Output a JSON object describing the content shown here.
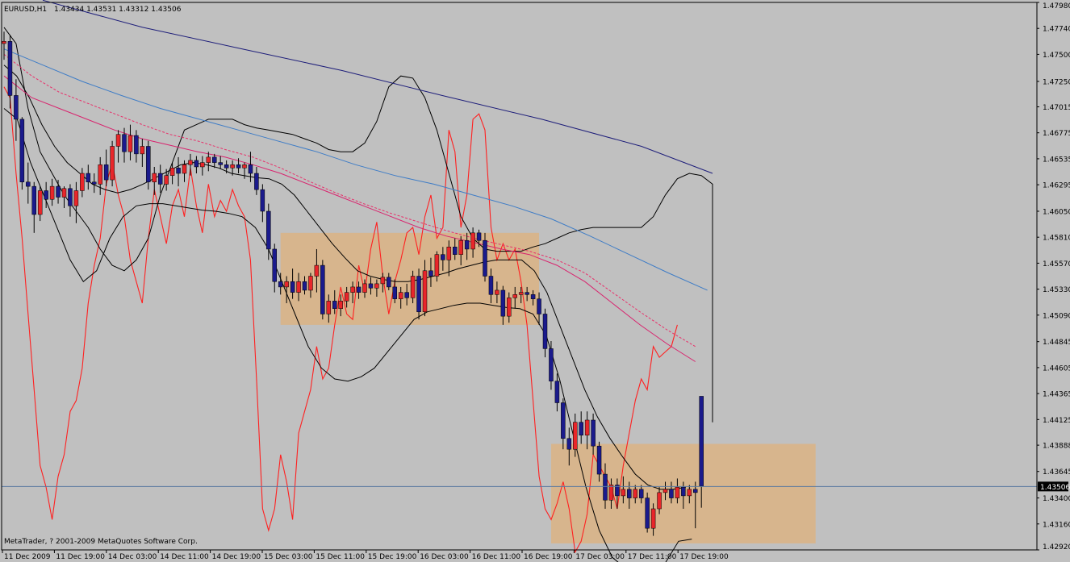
{
  "header": {
    "symbol": "EURUSD,H1",
    "ohlc": "1.43434 1.43531 1.43312 1.43506"
  },
  "footer": {
    "copyright": "MetaTrader, ? 2001-2009 MetaQuotes Software Corp."
  },
  "current_price": {
    "value": 1.43506,
    "label": "1.43506"
  },
  "colors": {
    "background": "#c0c0c0",
    "bull_candle": "#e8262a",
    "bear_candle": "#1a1a8c",
    "wick": "#000000",
    "red_oscillator": "#ff2020",
    "bollinger": "#000000",
    "ma_pink": "#d8246e",
    "ma_pink_dashed": "#e8306a",
    "ma_blue": "#3e7cc6",
    "ma_navy": "#1e1e7a",
    "zone_fill": "#d8b48a",
    "price_line": "#5878a0"
  },
  "chart_data": {
    "type": "candlestick",
    "symbol": "EURUSD",
    "timeframe": "H1",
    "ylim": [
      1.4292,
      1.4798
    ],
    "y_ticks": [
      "1.47980",
      "1.47740",
      "1.47500",
      "1.47250",
      "1.47015",
      "1.46775",
      "1.46535",
      "1.46295",
      "1.46050",
      "1.45810",
      "1.45570",
      "1.45330",
      "1.45090",
      "1.44845",
      "1.44605",
      "1.44365",
      "1.44125",
      "1.43888",
      "1.43645",
      "1.43400",
      "1.43160",
      "1.42920"
    ],
    "x_ticks": [
      "11 Dec 2009",
      "11 Dec 19:00",
      "14 Dec 03:00",
      "14 Dec 11:00",
      "14 Dec 19:00",
      "15 Dec 03:00",
      "15 Dec 11:00",
      "15 Dec 19:00",
      "16 Dec 03:00",
      "16 Dec 11:00",
      "16 Dec 19:00",
      "17 Dec 03:00",
      "17 Dec 11:00",
      "17 Dec 19:00"
    ],
    "grid": false,
    "zones": [
      {
        "from_bar": 46,
        "to_bar": 89,
        "top": 1.4585,
        "bottom": 1.45
      },
      {
        "from_bar": 91,
        "to_bar": 135,
        "top": 1.439,
        "bottom": 1.4298
      }
    ],
    "candles": [
      [
        1.476,
        1.4771,
        1.4745,
        1.4762
      ],
      [
        1.4762,
        1.4768,
        1.47,
        1.4712
      ],
      [
        1.4712,
        1.4727,
        1.467,
        1.469
      ],
      [
        1.469,
        1.4692,
        1.4625,
        1.4632
      ],
      [
        1.4632,
        1.465,
        1.4612,
        1.4628
      ],
      [
        1.4628,
        1.4632,
        1.4585,
        1.4602
      ],
      [
        1.4602,
        1.4628,
        1.4596,
        1.4624
      ],
      [
        1.4624,
        1.4632,
        1.4608,
        1.4616
      ],
      [
        1.4616,
        1.4635,
        1.461,
        1.4628
      ],
      [
        1.4628,
        1.4634,
        1.4612,
        1.4618
      ],
      [
        1.4618,
        1.4628,
        1.4608,
        1.4626
      ],
      [
        1.4626,
        1.463,
        1.46,
        1.461
      ],
      [
        1.461,
        1.4632,
        1.4594,
        1.4624
      ],
      [
        1.4624,
        1.4645,
        1.4618,
        1.464
      ],
      [
        1.464,
        1.4648,
        1.4625,
        1.4632
      ],
      [
        1.4632,
        1.464,
        1.4622,
        1.463
      ],
      [
        1.463,
        1.4655,
        1.462,
        1.4648
      ],
      [
        1.4648,
        1.4662,
        1.4628,
        1.4634
      ],
      [
        1.4634,
        1.467,
        1.4628,
        1.4665
      ],
      [
        1.4665,
        1.468,
        1.465,
        1.4676
      ],
      [
        1.4676,
        1.4682,
        1.465,
        1.466
      ],
      [
        1.466,
        1.4685,
        1.4652,
        1.4675
      ],
      [
        1.4675,
        1.468,
        1.465,
        1.4658
      ],
      [
        1.4658,
        1.4672,
        1.4646,
        1.4665
      ],
      [
        1.4665,
        1.467,
        1.4625,
        1.4632
      ],
      [
        1.4632,
        1.4646,
        1.462,
        1.464
      ],
      [
        1.464,
        1.4648,
        1.4622,
        1.463
      ],
      [
        1.463,
        1.4644,
        1.4624,
        1.4638
      ],
      [
        1.4638,
        1.465,
        1.463,
        1.4645
      ],
      [
        1.4645,
        1.4655,
        1.4628,
        1.464
      ],
      [
        1.464,
        1.4652,
        1.4632,
        1.4648
      ],
      [
        1.4648,
        1.4658,
        1.4638,
        1.4652
      ],
      [
        1.4652,
        1.4656,
        1.464,
        1.4646
      ],
      [
        1.4646,
        1.4656,
        1.4638,
        1.465
      ],
      [
        1.465,
        1.466,
        1.4642,
        1.4655
      ],
      [
        1.4655,
        1.4658,
        1.4645,
        1.465
      ],
      [
        1.465,
        1.4656,
        1.4644,
        1.4648
      ],
      [
        1.4648,
        1.4652,
        1.464,
        1.4645
      ],
      [
        1.4645,
        1.4652,
        1.4638,
        1.4648
      ],
      [
        1.4648,
        1.4654,
        1.464,
        1.4645
      ],
      [
        1.4645,
        1.465,
        1.4635,
        1.4648
      ],
      [
        1.4648,
        1.466,
        1.4632,
        1.464
      ],
      [
        1.464,
        1.4646,
        1.462,
        1.4625
      ],
      [
        1.4625,
        1.463,
        1.4595,
        1.4605
      ],
      [
        1.4605,
        1.4612,
        1.456,
        1.457
      ],
      [
        1.457,
        1.4575,
        1.453,
        1.454
      ],
      [
        1.454,
        1.4548,
        1.4528,
        1.4535
      ],
      [
        1.4535,
        1.4545,
        1.452,
        1.454
      ],
      [
        1.454,
        1.4552,
        1.4524,
        1.453
      ],
      [
        1.453,
        1.4548,
        1.4522,
        1.454
      ],
      [
        1.454,
        1.4545,
        1.4528,
        1.4532
      ],
      [
        1.4532,
        1.4548,
        1.4525,
        1.4545
      ],
      [
        1.4545,
        1.457,
        1.453,
        1.4555
      ],
      [
        1.4555,
        1.456,
        1.4505,
        1.451
      ],
      [
        1.451,
        1.4528,
        1.4502,
        1.4522
      ],
      [
        1.4522,
        1.4532,
        1.451,
        1.4515
      ],
      [
        1.4515,
        1.4528,
        1.4508,
        1.4522
      ],
      [
        1.4522,
        1.4535,
        1.4516,
        1.453
      ],
      [
        1.453,
        1.454,
        1.452,
        1.4535
      ],
      [
        1.4535,
        1.454,
        1.4524,
        1.453
      ],
      [
        1.453,
        1.4542,
        1.4525,
        1.4538
      ],
      [
        1.4538,
        1.4544,
        1.4528,
        1.4534
      ],
      [
        1.4534,
        1.4542,
        1.4526,
        1.4538
      ],
      [
        1.4538,
        1.4548,
        1.453,
        1.4544
      ],
      [
        1.4544,
        1.4548,
        1.4532,
        1.4535
      ],
      [
        1.4535,
        1.4542,
        1.452,
        1.4524
      ],
      [
        1.4524,
        1.4535,
        1.4515,
        1.453
      ],
      [
        1.453,
        1.4538,
        1.4518,
        1.4525
      ],
      [
        1.4525,
        1.455,
        1.452,
        1.4545
      ],
      [
        1.4545,
        1.4552,
        1.4505,
        1.4512
      ],
      [
        1.4512,
        1.456,
        1.4508,
        1.455
      ],
      [
        1.455,
        1.4562,
        1.4535,
        1.4545
      ],
      [
        1.4545,
        1.4568,
        1.454,
        1.4565
      ],
      [
        1.4565,
        1.4572,
        1.455,
        1.456
      ],
      [
        1.456,
        1.4578,
        1.4545,
        1.4572
      ],
      [
        1.4572,
        1.458,
        1.456,
        1.4565
      ],
      [
        1.4565,
        1.4582,
        1.4555,
        1.4578
      ],
      [
        1.4578,
        1.4585,
        1.456,
        1.457
      ],
      [
        1.457,
        1.459,
        1.4562,
        1.4585
      ],
      [
        1.4585,
        1.4588,
        1.4572,
        1.4578
      ],
      [
        1.4578,
        1.4585,
        1.454,
        1.4545
      ],
      [
        1.4545,
        1.4552,
        1.452,
        1.4528
      ],
      [
        1.4528,
        1.454,
        1.452,
        1.4532
      ],
      [
        1.4532,
        1.4536,
        1.45,
        1.4508
      ],
      [
        1.4508,
        1.453,
        1.4502,
        1.4525
      ],
      [
        1.4525,
        1.4535,
        1.4515,
        1.4528
      ],
      [
        1.4528,
        1.4535,
        1.452,
        1.453
      ],
      [
        1.453,
        1.4535,
        1.4522,
        1.4528
      ],
      [
        1.4528,
        1.4532,
        1.4518,
        1.4524
      ],
      [
        1.4524,
        1.453,
        1.45,
        1.451
      ],
      [
        1.451,
        1.4515,
        1.447,
        1.4478
      ],
      [
        1.4478,
        1.4485,
        1.444,
        1.4448
      ],
      [
        1.4448,
        1.4455,
        1.442,
        1.4428
      ],
      [
        1.4428,
        1.4432,
        1.4385,
        1.4395
      ],
      [
        1.4395,
        1.4405,
        1.437,
        1.4385
      ],
      [
        1.4385,
        1.4418,
        1.4378,
        1.441
      ],
      [
        1.441,
        1.442,
        1.439,
        1.4398
      ],
      [
        1.4398,
        1.442,
        1.4385,
        1.4412
      ],
      [
        1.4412,
        1.4418,
        1.438,
        1.4388
      ],
      [
        1.4388,
        1.4392,
        1.4355,
        1.4362
      ],
      [
        1.4362,
        1.4372,
        1.433,
        1.4338
      ],
      [
        1.4338,
        1.4358,
        1.433,
        1.4352
      ],
      [
        1.4352,
        1.4358,
        1.433,
        1.4342
      ],
      [
        1.4342,
        1.436,
        1.4335,
        1.4348
      ],
      [
        1.4348,
        1.4355,
        1.433,
        1.434
      ],
      [
        1.434,
        1.4352,
        1.4335,
        1.4348
      ],
      [
        1.4348,
        1.4352,
        1.4335,
        1.434
      ],
      [
        1.434,
        1.4345,
        1.4308,
        1.4312
      ],
      [
        1.4312,
        1.4335,
        1.4305,
        1.433
      ],
      [
        1.433,
        1.435,
        1.4325,
        1.4345
      ],
      [
        1.4345,
        1.4355,
        1.4338,
        1.4348
      ],
      [
        1.4348,
        1.4355,
        1.4335,
        1.434
      ],
      [
        1.434,
        1.4358,
        1.4335,
        1.435
      ],
      [
        1.435,
        1.4355,
        1.433,
        1.4342
      ],
      [
        1.4342,
        1.4352,
        1.4335,
        1.4348
      ],
      [
        1.4348,
        1.4355,
        1.4312,
        1.4345
      ],
      [
        1.4434,
        1.4353,
        1.4331,
        1.4351
      ]
    ],
    "series": [
      {
        "values": [
          1.472,
          1.471,
          1.464,
          1.458,
          1.451,
          1.444,
          1.437,
          1.435,
          1.432,
          1.436,
          1.438,
          1.442,
          1.443,
          1.446,
          1.452,
          1.4555,
          1.458,
          1.463,
          1.465,
          1.462,
          1.46,
          1.456,
          1.454,
          1.452,
          1.458,
          1.4625,
          1.46,
          1.4575,
          1.461,
          1.4625,
          1.46,
          1.4645,
          1.461,
          1.4585,
          1.463,
          1.46,
          1.4615,
          1.4605,
          1.4625,
          1.461,
          1.46,
          1.456,
          1.445,
          1.433,
          1.431,
          1.433,
          1.438,
          1.4355,
          1.432,
          1.44,
          1.442,
          1.444,
          1.448,
          1.445,
          1.446,
          1.45,
          1.4535,
          1.451,
          1.4505,
          1.4555,
          1.453,
          1.457,
          1.4595,
          1.4545,
          1.451,
          1.454,
          1.456,
          1.4585,
          1.459,
          1.4565,
          1.46,
          1.462,
          1.458,
          1.459,
          1.468,
          1.466,
          1.459,
          1.462,
          1.469,
          1.4695,
          1.468,
          1.459,
          1.456,
          1.4575,
          1.456,
          1.457,
          1.454,
          1.45,
          1.443,
          1.436,
          1.433,
          1.432,
          1.4335,
          1.4355,
          1.433,
          1.429,
          1.43,
          1.4325,
          1.438,
          1.437,
          1.436,
          1.435,
          1.433,
          1.437,
          1.44,
          1.443,
          1.445,
          1.444,
          1.448,
          1.447,
          1.4475,
          1.448,
          1.45
        ]
      },
      {
        "values": [
          1.4775,
          1.476,
          1.47,
          1.466,
          1.464,
          1.462,
          1.4605,
          1.459,
          1.457,
          1.4555,
          1.455,
          1.456,
          1.458,
          1.462,
          1.465,
          1.468,
          1.4685,
          1.469,
          1.469,
          1.469,
          1.4685,
          1.4682,
          1.468,
          1.4678,
          1.4676,
          1.4672,
          1.4668,
          1.4662,
          1.466,
          1.466,
          1.4668,
          1.4688,
          1.472,
          1.473,
          1.4728,
          1.471,
          1.468,
          1.464,
          1.46,
          1.458,
          1.457,
          1.4568,
          1.4568,
          1.4568,
          1.4572,
          1.4575,
          1.458,
          1.4585,
          1.4588,
          1.459,
          1.459,
          1.459,
          1.459,
          1.459,
          1.46,
          1.462,
          1.4635,
          1.464,
          1.4638,
          1.463,
          1.461,
          1.458,
          1.454,
          1.448,
          1.444,
          1.441
        ]
      },
      {
        "values": [
          1.474,
          1.473,
          1.471,
          1.4685,
          1.4665,
          1.465,
          1.464,
          1.463,
          1.4625,
          1.4622,
          1.4625,
          1.463,
          1.4636,
          1.4642,
          1.4648,
          1.465,
          1.4648,
          1.4645,
          1.464,
          1.4638,
          1.4636,
          1.4635,
          1.463,
          1.462,
          1.4605,
          1.459,
          1.4575,
          1.4562,
          1.455,
          1.4545,
          1.4542,
          1.454,
          1.454,
          1.4542,
          1.4545,
          1.4548,
          1.4552,
          1.4555,
          1.4558,
          1.456,
          1.456,
          1.456,
          1.455,
          1.453,
          1.45,
          1.447,
          1.444,
          1.4415,
          1.4395,
          1.4378,
          1.4362,
          1.4352,
          1.4348,
          1.4348,
          1.435
        ]
      },
      {
        "values": [
          1.47,
          1.469,
          1.465,
          1.462,
          1.459,
          1.456,
          1.454,
          1.455,
          1.458,
          1.46,
          1.461,
          1.4612,
          1.4612,
          1.461,
          1.4608,
          1.4606,
          1.4605,
          1.4603,
          1.46,
          1.459,
          1.457,
          1.454,
          1.451,
          1.448,
          1.446,
          1.445,
          1.4448,
          1.4452,
          1.446,
          1.4475,
          1.449,
          1.4505,
          1.4512,
          1.4515,
          1.4518,
          1.452,
          1.452,
          1.4518,
          1.4516,
          1.4515,
          1.451,
          1.449,
          1.445,
          1.44,
          1.435,
          1.431,
          1.4285,
          1.4275,
          1.4272,
          1.4275,
          1.428,
          1.43,
          1.4302
        ]
      },
      {
        "values": [
          1.473,
          1.471,
          1.47,
          1.469,
          1.468,
          1.4672,
          1.4666,
          1.466,
          1.4655,
          1.4648,
          1.464,
          1.463,
          1.462,
          1.461,
          1.46,
          1.459,
          1.4582,
          1.4576,
          1.457,
          1.4565,
          1.4555,
          1.454,
          1.452,
          1.45,
          1.4482,
          1.4466
        ]
      },
      {
        "values": [
          1.475,
          1.473,
          1.4715,
          1.4705,
          1.4695,
          1.4685,
          1.4676,
          1.467,
          1.4662,
          1.4655,
          1.4645,
          1.4633,
          1.4622,
          1.4612,
          1.4603,
          1.4595,
          1.4587,
          1.458,
          1.4574,
          1.4568,
          1.456,
          1.4548,
          1.453,
          1.4512,
          1.4495,
          1.448
        ]
      },
      {
        "values": [
          1.4755,
          1.474,
          1.4725,
          1.4712,
          1.47,
          1.469,
          1.468,
          1.467,
          1.466,
          1.4648,
          1.4638,
          1.463,
          1.462,
          1.461,
          1.4598,
          1.4582,
          1.4565,
          1.4548,
          1.4532
        ]
      },
      {
        "values": [
          1.48,
          1.4775,
          1.4755,
          1.4735,
          1.4712,
          1.469,
          1.4665,
          1.464
        ]
      }
    ]
  }
}
